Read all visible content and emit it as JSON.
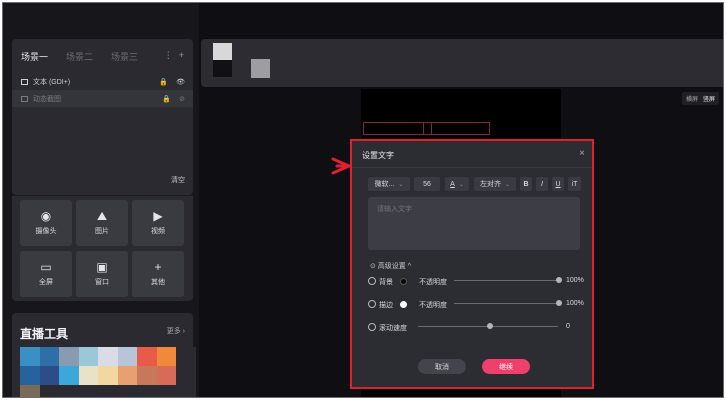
{
  "scenes": {
    "tabs": [
      "场景一",
      "场景二",
      "场景三"
    ],
    "tools": [
      "⋮",
      "+"
    ],
    "layers": [
      {
        "label": "文本 (GDI+)",
        "icons": [
          "🔒",
          "👁"
        ]
      },
      {
        "label": "动态截图",
        "icons": [
          "🔒",
          "⊘"
        ]
      }
    ],
    "clear_label": "清空"
  },
  "sources": [
    {
      "label": "摄像头",
      "icon": "◉"
    },
    {
      "label": "图片",
      "icon": "⛰"
    },
    {
      "label": "视频",
      "icon": "▶"
    },
    {
      "label": "全屏",
      "icon": "▭"
    },
    {
      "label": "窗口",
      "icon": "▣"
    },
    {
      "label": "其他",
      "icon": "+"
    }
  ],
  "tools_panel": {
    "title": "直播工具",
    "more": "更多 ›"
  },
  "mosaic_colors": [
    "#3a8fc4",
    "#2f6fa8",
    "#8a9ab0",
    "#9ac8d8",
    "#d8dce6",
    "#b8c4d8",
    "#e85a4a",
    "#f08a3a",
    "#2a2a30",
    "#26639c",
    "#2c4d8a",
    "#3aa8d8",
    "#e8e2c8",
    "#f0d8a0",
    "#e8a070",
    "#c8785a",
    "#d86a5a",
    "#2a2a30",
    "#7a6a5a",
    "#2a2a30",
    "#2a2a30",
    "#2a2a30",
    "#2a2a30",
    "#2a2a30",
    "#2a2a30",
    "#2a2a30",
    "#2a2a30"
  ],
  "view_chip": {
    "left": "横屏",
    "right": "竖屏"
  },
  "dialog": {
    "title": "设置文字",
    "close": "×",
    "font": "微软...",
    "size": "56",
    "color_btn": "A",
    "align": "左对齐",
    "styles": [
      "B",
      "I",
      "U",
      "iT"
    ],
    "placeholder": "请输入文字",
    "advanced": "⊙ 高级设置 ^",
    "rows": [
      {
        "label": "背景",
        "dot": "#0a0a0a",
        "sub": "不透明度",
        "value": "100%"
      },
      {
        "label": "描边",
        "dot": "#ffffff",
        "sub": "不透明度",
        "value": "100%"
      },
      {
        "label": "滚动速度",
        "value": "0"
      }
    ],
    "cancel": "取消",
    "ok": "继续"
  }
}
